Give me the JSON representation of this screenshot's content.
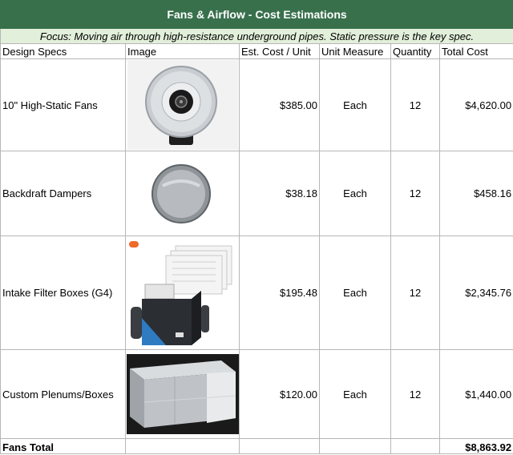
{
  "title": "Fans & Airflow - Cost Estimations",
  "focus": "Focus: Moving air through high-resistance underground pipes. Static pressure is the key spec.",
  "headers": [
    "Design Specs",
    "Image",
    "Est. Cost / Unit",
    "Unit Measure",
    "Quantity",
    "Total Cost"
  ],
  "rows": [
    {
      "spec": "10\" High-Static Fans",
      "image": "inline-fan-icon",
      "unit_cost": "$385.00",
      "measure": "Each",
      "qty": "12",
      "total": "$4,620.00"
    },
    {
      "spec": "Backdraft Dampers",
      "image": "round-damper-icon",
      "unit_cost": "$38.18",
      "measure": "Each",
      "qty": "12",
      "total": "$458.16"
    },
    {
      "spec": "Intake Filter Boxes (G4)",
      "image": "filter-box-icon",
      "unit_cost": "$195.48",
      "measure": "Each",
      "qty": "12",
      "total": "$2,345.76"
    },
    {
      "spec": "Custom Plenums/Boxes",
      "image": "sheet-metal-plenum-icon",
      "unit_cost": "$120.00",
      "measure": "Each",
      "qty": "12",
      "total": "$1,440.00"
    }
  ],
  "total": {
    "label": "Fans Total",
    "value": "$8,863.92"
  },
  "colors": {
    "title_bg": "#38704c",
    "focus_bg": "#e2efda"
  }
}
